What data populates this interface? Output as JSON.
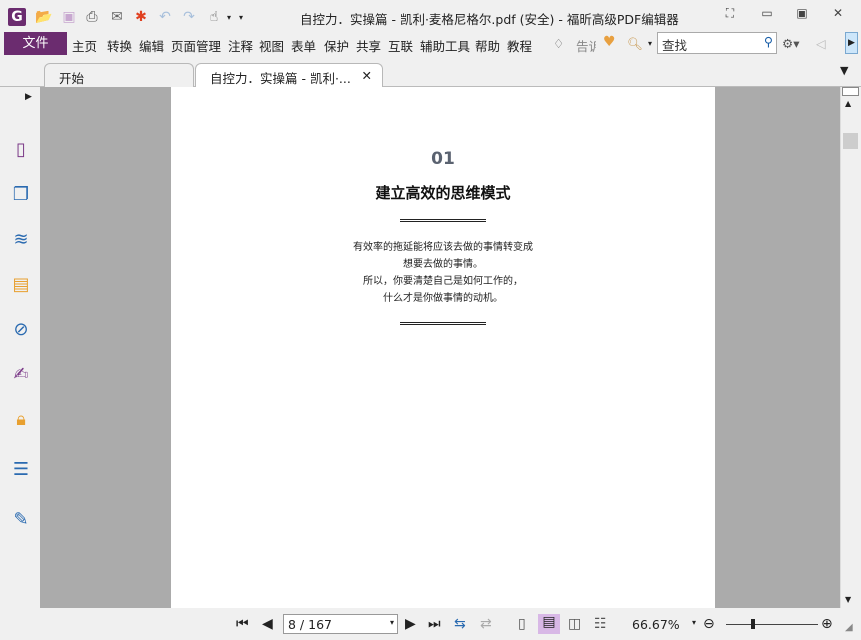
{
  "window": {
    "title": "自控力．实操篇 - 凯利·麦格尼格尔.pdf (安全) - 福昕高级PDF编辑器"
  },
  "menu": {
    "file": "文件",
    "items": [
      "主页",
      "转换",
      "编辑",
      "页面管理",
      "注释",
      "视图",
      "表单",
      "保护",
      "共享",
      "互联",
      "辅助工具",
      "帮助",
      "教程"
    ],
    "tell": "告诉",
    "search_placeholder": "查找"
  },
  "tabs": [
    {
      "label": "开始",
      "active": false
    },
    {
      "label": "自控力．实操篇 - 凯利·...",
      "active": true
    }
  ],
  "document": {
    "chapter_number": "01",
    "chapter_title": "建立高效的思维模式",
    "lines": [
      "有效率的拖延能将应该去做的事情转变成",
      "想要去做的事情。",
      "所以，你要清楚自己是如何工作的，",
      "什么才是你做事情的动机。"
    ]
  },
  "status": {
    "page_input": "8 / 167",
    "zoom": "66.67%",
    "zoom_slider_fraction": 0.27
  },
  "colors": {
    "brand": "#6b2c6f",
    "viewer_bg": "#ababab"
  }
}
